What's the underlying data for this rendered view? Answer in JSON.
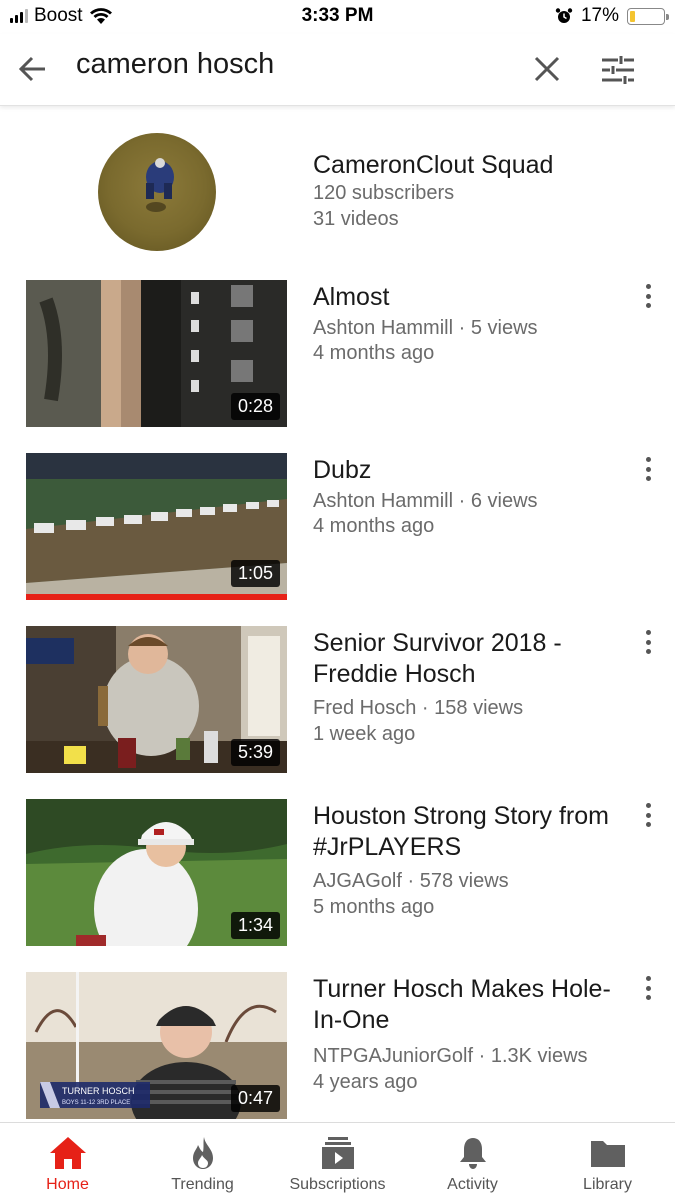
{
  "status_bar": {
    "carrier": "Boost",
    "time": "3:33 PM",
    "battery": "17%",
    "battery_level": 0.17
  },
  "search": {
    "query": "cameron hosch"
  },
  "channel": {
    "title": "CameronClout Squad",
    "subscribers": "120 subscribers",
    "videos": "31 videos"
  },
  "videos": [
    {
      "title": "Almost",
      "channel": "Ashton Hammill",
      "views": "5 views",
      "age": "4 months ago",
      "duration": "0:28"
    },
    {
      "title": "Dubz",
      "channel": "Ashton Hammill",
      "views": "6 views",
      "age": "4 months ago",
      "duration": "1:05",
      "watched": true
    },
    {
      "title": "Senior Survivor 2018 - Freddie Hosch",
      "channel": "Fred Hosch",
      "views": "158 views",
      "age": "1 week ago",
      "duration": "5:39"
    },
    {
      "title": "Houston Strong Story from #JrPLAYERS",
      "channel": "AJGAGolf",
      "views": "578 views",
      "age": "5 months ago",
      "duration": "1:34"
    },
    {
      "title": "Turner Hosch Makes Hole-In-One",
      "channel": "NTPGAJuniorGolf",
      "views": "1.3K views",
      "age": "4 years ago",
      "duration": "0:47",
      "thumb_caption": [
        "TURNER HOSCH",
        "BOYS 11-12 3RD PLACE"
      ]
    }
  ],
  "nav": [
    {
      "label": "Home",
      "icon": "home-icon",
      "active": true
    },
    {
      "label": "Trending",
      "icon": "flame-icon"
    },
    {
      "label": "Subscriptions",
      "icon": "subscriptions-icon"
    },
    {
      "label": "Activity",
      "icon": "bell-icon"
    },
    {
      "label": "Library",
      "icon": "folder-icon"
    }
  ],
  "colors": {
    "accent": "#e62117",
    "meta_text": "#6b6b6b",
    "title_text": "#1a1a1a"
  }
}
